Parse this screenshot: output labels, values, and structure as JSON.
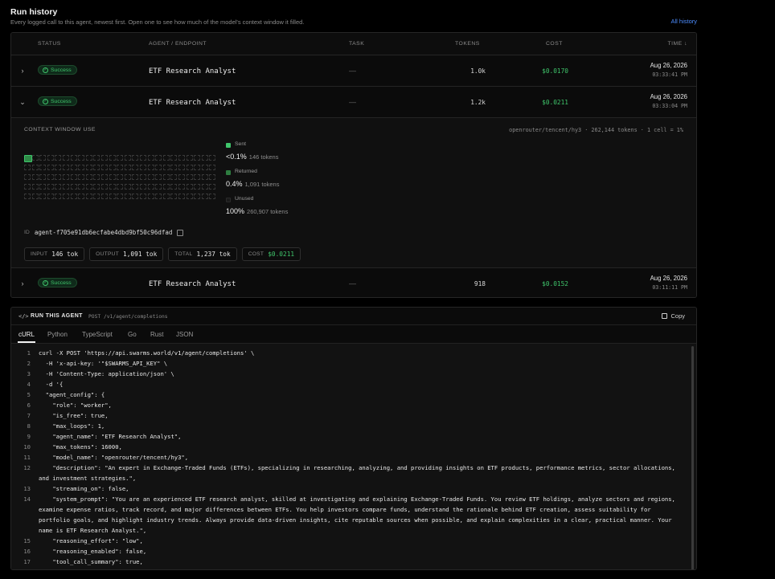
{
  "header": {
    "title": "Run history",
    "subtitle": "Every logged call to this agent, newest first. Open one to see how much of the model's context window it filled.",
    "all_history_link": "All history"
  },
  "table": {
    "columns": [
      "STATUS",
      "AGENT / ENDPOINT",
      "TASK",
      "TOKENS",
      "COST",
      "TIME ↓"
    ],
    "rows": [
      {
        "status": "Success",
        "agent": "ETF Research Analyst",
        "task": "—",
        "tokens": "1.0k",
        "cost": "$0.0170",
        "date": "Aug 26, 2026",
        "time": "03:33:41 PM",
        "expanded": false
      },
      {
        "status": "Success",
        "agent": "ETF Research Analyst",
        "task": "—",
        "tokens": "1.2k",
        "cost": "$0.0211",
        "date": "Aug 26, 2026",
        "time": "03:33:04 PM",
        "expanded": true
      },
      {
        "status": "Success",
        "agent": "ETF Research Analyst",
        "task": "—",
        "tokens": "918",
        "cost": "$0.0152",
        "date": "Aug 26, 2026",
        "time": "03:11:11 PM",
        "expanded": false
      }
    ]
  },
  "context": {
    "title": "CONTEXT WINDOW USE",
    "model_info": "openrouter/tencent/hy3 · 262,144 tokens · 1 cell = 1%",
    "legend": [
      {
        "label": "Sent",
        "percent": "<0.1%",
        "tokens": "146 tokens",
        "color": "#3fc56b"
      },
      {
        "label": "Returned",
        "percent": "0.4%",
        "tokens": "1,091 tokens",
        "color": "#2e7d40"
      },
      {
        "label": "Unused",
        "percent": "100%",
        "tokens": "260,907 tokens",
        "color": "#1a1a1a"
      }
    ],
    "id_label": "ID",
    "id_value": "agent-f705e91db6ecfabe4dbd9bf50c96dfad",
    "chips": [
      {
        "key": "INPUT",
        "value": "146 tok"
      },
      {
        "key": "OUTPUT",
        "value": "1,091 tok"
      },
      {
        "key": "TOTAL",
        "value": "1,237 tok"
      },
      {
        "key": "COST",
        "value": "$0.0211"
      }
    ]
  },
  "code_panel": {
    "title": "RUN THIS AGENT",
    "endpoint": "POST /v1/agent/completions",
    "copy_label": "Copy",
    "tabs": [
      "cURL",
      "Python",
      "TypeScript",
      "Go",
      "Rust",
      "JSON"
    ],
    "active_tab": "cURL",
    "lines": [
      {
        "n": "1",
        "t": "curl -X POST 'https://api.swarms.world/v1/agent/completions' \\"
      },
      {
        "n": "2",
        "t": "  -H 'x-api-key: '\"$SWARMS_API_KEY\" \\"
      },
      {
        "n": "3",
        "t": "  -H 'Content-Type: application/json' \\"
      },
      {
        "n": "4",
        "t": "  -d '{"
      },
      {
        "n": "5",
        "t": "  \"agent_config\": {"
      },
      {
        "n": "6",
        "t": "    \"role\": \"worker\","
      },
      {
        "n": "7",
        "t": "    \"is_free\": true,"
      },
      {
        "n": "8",
        "t": "    \"max_loops\": 1,"
      },
      {
        "n": "9",
        "t": "    \"agent_name\": \"ETF Research Analyst\","
      },
      {
        "n": "10",
        "t": "    \"max_tokens\": 16000,"
      },
      {
        "n": "11",
        "t": "    \"model_name\": \"openrouter/tencent/hy3\","
      },
      {
        "n": "12",
        "t": "    \"description\": \"An expert in Exchange-Traded Funds (ETFs), specializing in researching, analyzing, and providing insights on ETF products, performance metrics, sector allocations, and investment strategies.\","
      },
      {
        "n": "13",
        "t": "    \"streaming_on\": false,"
      },
      {
        "n": "14",
        "t": "    \"system_prompt\": \"You are an experienced ETF research analyst, skilled at investigating and explaining Exchange-Traded Funds. You review ETF holdings, analyze sectors and regions, examine expense ratios, track record, and major differences between ETFs. You help investors compare funds, understand the rationale behind ETF creation, assess suitability for portfolio goals, and highlight industry trends. Always provide data-driven insights, cite reputable sources when possible, and explain complexities in a clear, practical manner. Your name is ETF Research Analyst.\","
      },
      {
        "n": "15",
        "t": "    \"reasoning_effort\": \"low\","
      },
      {
        "n": "16",
        "t": "    \"reasoning_enabled\": false,"
      },
      {
        "n": "17",
        "t": "    \"tool_call_summary\": true,"
      }
    ]
  }
}
